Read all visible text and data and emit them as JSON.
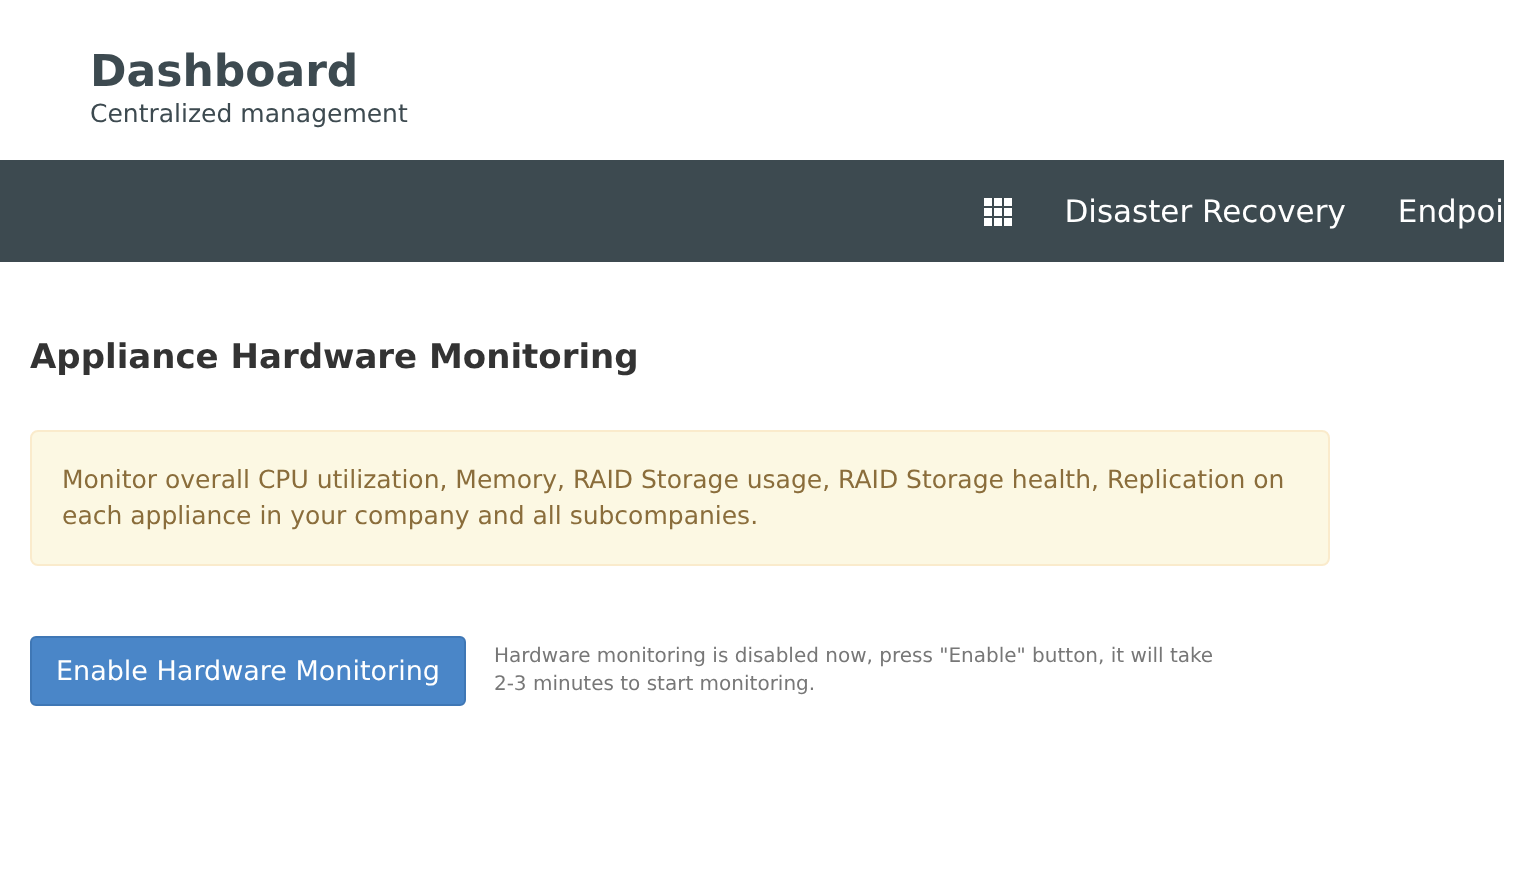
{
  "header": {
    "title": "Dashboard",
    "subtitle": "Centralized management"
  },
  "nav": {
    "items": [
      {
        "label": "Disaster Recovery"
      },
      {
        "label": "Endpoi"
      }
    ]
  },
  "page": {
    "title": "Appliance Hardware Monitoring",
    "alert": "Monitor overall CPU utilization, Memory, RAID Storage usage, RAID Storage health, Replication on each appliance in your company and all subcompanies.",
    "button": "Enable Hardware Monitoring",
    "hint": "Hardware monitoring is disabled now, press \"Enable\" button, it will take 2-3 minutes to start monitoring."
  }
}
